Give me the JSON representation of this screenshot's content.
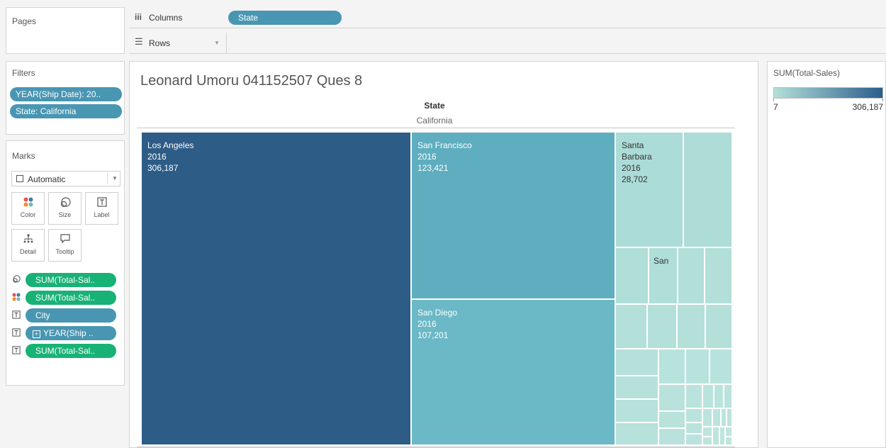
{
  "pages": {
    "title": "Pages"
  },
  "columns": {
    "label": "Columns",
    "pill": "State"
  },
  "rows": {
    "label": "Rows"
  },
  "filters": {
    "title": "Filters",
    "items": [
      "YEAR(Ship Date): 20..",
      "State: California"
    ]
  },
  "marks": {
    "title": "Marks",
    "type": "Automatic",
    "buttons": {
      "color": "Color",
      "size": "Size",
      "label": "Label",
      "detail": "Detail",
      "tooltip": "Tooltip"
    },
    "pills": [
      "SUM(Total-Sal..",
      "SUM(Total-Sal..",
      "City",
      "YEAR(Ship ..",
      "SUM(Total-Sal.."
    ]
  },
  "view": {
    "title": "Leonard Umoru  041152507 Ques 8",
    "header_field": "State",
    "header_value": "California"
  },
  "legend": {
    "title": "SUM(Total-Sales)",
    "min": "7",
    "max": "306,187",
    "color_low": "#b2e0da",
    "color_high": "#2b5d8a"
  },
  "treemap": {
    "tiles": [
      {
        "city": "Los Angeles",
        "year": "2016",
        "value": "306,187"
      },
      {
        "city": "San Francisco",
        "year": "2016",
        "value": "123,421"
      },
      {
        "city": "San Diego",
        "year": "2016",
        "value": "107,201"
      },
      {
        "city": "Santa Barbara",
        "year": "2016",
        "value": "28,702"
      },
      {
        "city": "San",
        "year": "",
        "value": ""
      }
    ]
  }
}
